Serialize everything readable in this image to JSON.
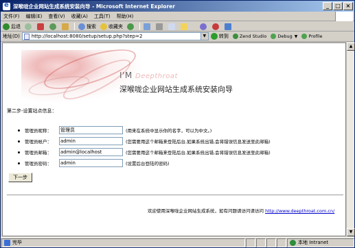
{
  "window": {
    "title": "深喉咙企业网站生成系统安装向导 - Microsoft Internet Explorer",
    "buttons": {
      "minimize": "_",
      "maximize": "□",
      "close": "×"
    }
  },
  "menubar": {
    "items": [
      "文件(F)",
      "编辑(E)",
      "查看(V)",
      "收藏(A)",
      "工具(T)",
      "帮助(H)"
    ]
  },
  "toolbar": {
    "back": "后退",
    "search": "搜索",
    "favorites": "收藏夹"
  },
  "addressbar": {
    "label": "地址(D)",
    "url": "http://localhost:8080/setup/setup.php?step=2",
    "go": "转到",
    "ext1": "Zend Studio",
    "ext2": "Debug",
    "ext3": "Profile"
  },
  "page": {
    "brand": "I'M",
    "brand_tm": "Deepthroat",
    "title": "深喉咙企业网站生成系统安装向导",
    "step": "第二步-设置站点信息：",
    "fields": [
      {
        "label": "管理员昵称：",
        "value": "管理员",
        "hint": "(用来在系统中显示你的名字，可以为中文。)"
      },
      {
        "label": "管理员帐户：",
        "value": "admin",
        "hint": "(您需要用这个邮箱来登陆后台,如果系统出错,会将错误信息发送至此邮箱)"
      },
      {
        "label": "管理员邮箱：",
        "value": "admin@localhost",
        "hint": "(您需要用这个邮箱来登陆后台,如果系统出错,会将错误信息发送至此邮箱)"
      },
      {
        "label": "管理员密码：",
        "value": "admin",
        "hint": "(设置后台登陆的密码)"
      }
    ],
    "next_button": "下一步",
    "footer_text": "欢迎使用深喉咙企业网站生成系统，如有问题请访问请访问",
    "footer_link": "http://www.deepthroat.com.cn/"
  },
  "statusbar": {
    "status": "完毕",
    "zone": "本地 Intranet"
  }
}
